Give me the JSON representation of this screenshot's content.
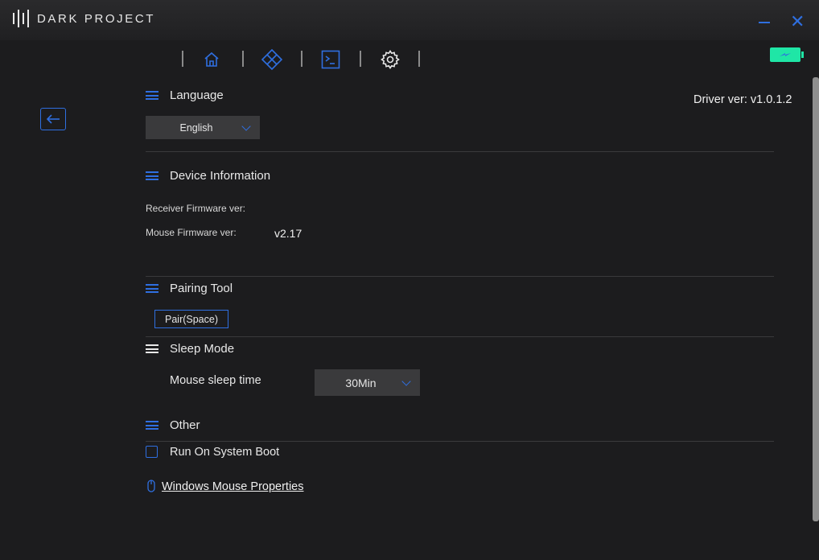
{
  "app": {
    "brand": "DARK PROJECT",
    "accent_color": "#2f6fe0",
    "battery_color": "#1fe6a6"
  },
  "window_controls": {
    "minimize_icon": "minimize-icon",
    "close_icon": "close-icon"
  },
  "nav": {
    "items": [
      {
        "icon": "home-icon"
      },
      {
        "icon": "diamond-grid-icon"
      },
      {
        "icon": "terminal-icon"
      },
      {
        "icon": "gear-icon"
      }
    ],
    "battery_icon": "battery-charging-icon"
  },
  "driver": {
    "version_text": "Driver ver: v1.0.1.2"
  },
  "sections": {
    "language": {
      "title": "Language",
      "selected": "English"
    },
    "device_info": {
      "title": "Device Information",
      "receiver_label": "Receiver Firmware ver:",
      "receiver_value": "",
      "mouse_label": "Mouse Firmware ver:",
      "mouse_value": "v2.17"
    },
    "pairing": {
      "title": "Pairing Tool",
      "button_label": "Pair(Space)"
    },
    "sleep": {
      "title": "Sleep Mode",
      "label": "Mouse sleep time",
      "selected": "30Min"
    },
    "other": {
      "title": "Other",
      "run_on_boot_label": "Run On System Boot",
      "run_on_boot_checked": false,
      "mouse_props_link": "Windows Mouse Properties"
    }
  }
}
